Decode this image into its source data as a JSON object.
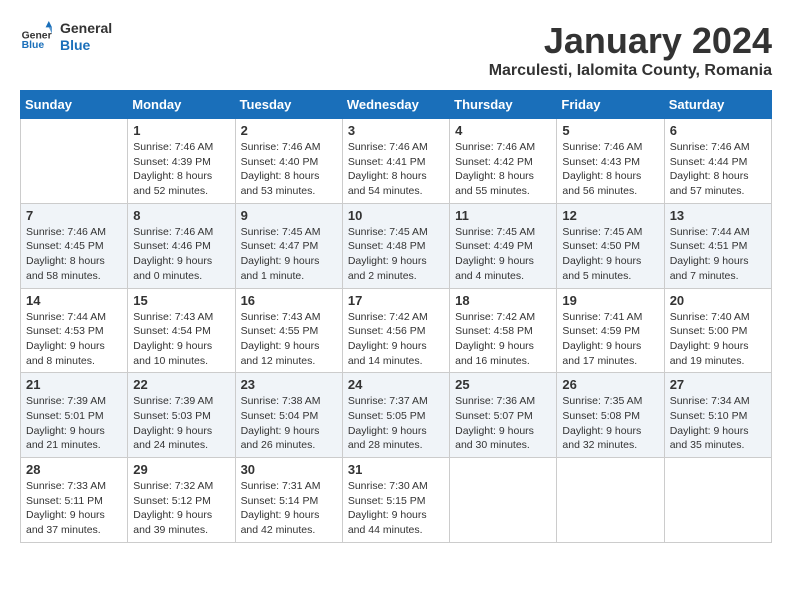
{
  "header": {
    "logo_general": "General",
    "logo_blue": "Blue",
    "title": "January 2024",
    "location": "Marculesti, Ialomita County, Romania"
  },
  "weekdays": [
    "Sunday",
    "Monday",
    "Tuesday",
    "Wednesday",
    "Thursday",
    "Friday",
    "Saturday"
  ],
  "weeks": [
    [
      {
        "day": "",
        "info": ""
      },
      {
        "day": "1",
        "info": "Sunrise: 7:46 AM\nSunset: 4:39 PM\nDaylight: 8 hours\nand 52 minutes."
      },
      {
        "day": "2",
        "info": "Sunrise: 7:46 AM\nSunset: 4:40 PM\nDaylight: 8 hours\nand 53 minutes."
      },
      {
        "day": "3",
        "info": "Sunrise: 7:46 AM\nSunset: 4:41 PM\nDaylight: 8 hours\nand 54 minutes."
      },
      {
        "day": "4",
        "info": "Sunrise: 7:46 AM\nSunset: 4:42 PM\nDaylight: 8 hours\nand 55 minutes."
      },
      {
        "day": "5",
        "info": "Sunrise: 7:46 AM\nSunset: 4:43 PM\nDaylight: 8 hours\nand 56 minutes."
      },
      {
        "day": "6",
        "info": "Sunrise: 7:46 AM\nSunset: 4:44 PM\nDaylight: 8 hours\nand 57 minutes."
      }
    ],
    [
      {
        "day": "7",
        "info": "Sunrise: 7:46 AM\nSunset: 4:45 PM\nDaylight: 8 hours\nand 58 minutes."
      },
      {
        "day": "8",
        "info": "Sunrise: 7:46 AM\nSunset: 4:46 PM\nDaylight: 9 hours\nand 0 minutes."
      },
      {
        "day": "9",
        "info": "Sunrise: 7:45 AM\nSunset: 4:47 PM\nDaylight: 9 hours\nand 1 minute."
      },
      {
        "day": "10",
        "info": "Sunrise: 7:45 AM\nSunset: 4:48 PM\nDaylight: 9 hours\nand 2 minutes."
      },
      {
        "day": "11",
        "info": "Sunrise: 7:45 AM\nSunset: 4:49 PM\nDaylight: 9 hours\nand 4 minutes."
      },
      {
        "day": "12",
        "info": "Sunrise: 7:45 AM\nSunset: 4:50 PM\nDaylight: 9 hours\nand 5 minutes."
      },
      {
        "day": "13",
        "info": "Sunrise: 7:44 AM\nSunset: 4:51 PM\nDaylight: 9 hours\nand 7 minutes."
      }
    ],
    [
      {
        "day": "14",
        "info": "Sunrise: 7:44 AM\nSunset: 4:53 PM\nDaylight: 9 hours\nand 8 minutes."
      },
      {
        "day": "15",
        "info": "Sunrise: 7:43 AM\nSunset: 4:54 PM\nDaylight: 9 hours\nand 10 minutes."
      },
      {
        "day": "16",
        "info": "Sunrise: 7:43 AM\nSunset: 4:55 PM\nDaylight: 9 hours\nand 12 minutes."
      },
      {
        "day": "17",
        "info": "Sunrise: 7:42 AM\nSunset: 4:56 PM\nDaylight: 9 hours\nand 14 minutes."
      },
      {
        "day": "18",
        "info": "Sunrise: 7:42 AM\nSunset: 4:58 PM\nDaylight: 9 hours\nand 16 minutes."
      },
      {
        "day": "19",
        "info": "Sunrise: 7:41 AM\nSunset: 4:59 PM\nDaylight: 9 hours\nand 17 minutes."
      },
      {
        "day": "20",
        "info": "Sunrise: 7:40 AM\nSunset: 5:00 PM\nDaylight: 9 hours\nand 19 minutes."
      }
    ],
    [
      {
        "day": "21",
        "info": "Sunrise: 7:39 AM\nSunset: 5:01 PM\nDaylight: 9 hours\nand 21 minutes."
      },
      {
        "day": "22",
        "info": "Sunrise: 7:39 AM\nSunset: 5:03 PM\nDaylight: 9 hours\nand 24 minutes."
      },
      {
        "day": "23",
        "info": "Sunrise: 7:38 AM\nSunset: 5:04 PM\nDaylight: 9 hours\nand 26 minutes."
      },
      {
        "day": "24",
        "info": "Sunrise: 7:37 AM\nSunset: 5:05 PM\nDaylight: 9 hours\nand 28 minutes."
      },
      {
        "day": "25",
        "info": "Sunrise: 7:36 AM\nSunset: 5:07 PM\nDaylight: 9 hours\nand 30 minutes."
      },
      {
        "day": "26",
        "info": "Sunrise: 7:35 AM\nSunset: 5:08 PM\nDaylight: 9 hours\nand 32 minutes."
      },
      {
        "day": "27",
        "info": "Sunrise: 7:34 AM\nSunset: 5:10 PM\nDaylight: 9 hours\nand 35 minutes."
      }
    ],
    [
      {
        "day": "28",
        "info": "Sunrise: 7:33 AM\nSunset: 5:11 PM\nDaylight: 9 hours\nand 37 minutes."
      },
      {
        "day": "29",
        "info": "Sunrise: 7:32 AM\nSunset: 5:12 PM\nDaylight: 9 hours\nand 39 minutes."
      },
      {
        "day": "30",
        "info": "Sunrise: 7:31 AM\nSunset: 5:14 PM\nDaylight: 9 hours\nand 42 minutes."
      },
      {
        "day": "31",
        "info": "Sunrise: 7:30 AM\nSunset: 5:15 PM\nDaylight: 9 hours\nand 44 minutes."
      },
      {
        "day": "",
        "info": ""
      },
      {
        "day": "",
        "info": ""
      },
      {
        "day": "",
        "info": ""
      }
    ]
  ]
}
